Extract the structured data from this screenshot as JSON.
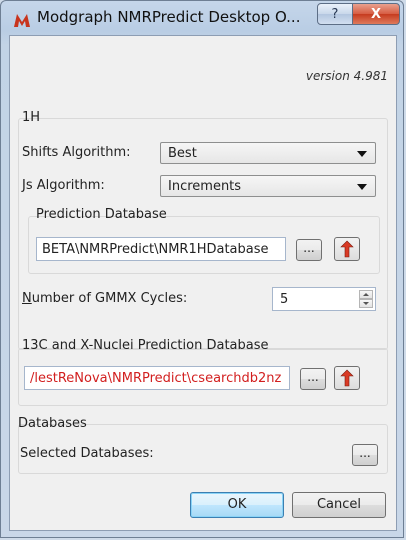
{
  "window": {
    "title": "Modgraph NMRPredict Desktop O...",
    "help_label": "?",
    "close_label": "X"
  },
  "version": "version 4.981",
  "h1_group": {
    "label": "1H",
    "shifts_label": "Shifts Algorithm:",
    "shifts_value": "Best",
    "js_label": "Js Algorithm:",
    "js_value": "Increments",
    "prediction_db": {
      "label": "Prediction Database",
      "path": "BETA\\NMRPredict\\NMR1HDatabase",
      "browse_label": "..."
    },
    "gmmx": {
      "label_prefix": "N",
      "label_rest": "umber of GMMX Cycles:",
      "value": "5"
    }
  },
  "c13_group": {
    "label": "13C and X-Nuclei Prediction Database",
    "path": "/lestReNova\\NMRPredict\\csearchdb2nz",
    "browse_label": "..."
  },
  "databases_group": {
    "label": "Databases",
    "selected_label": "Selected Databases:",
    "browse_label": "..."
  },
  "buttons": {
    "ok": "OK",
    "cancel": "Cancel"
  },
  "colors": {
    "path_text": "#d21f1f",
    "reset_arrow": "#d93a25",
    "close_button": "#c63b1f"
  },
  "icons": {
    "app": "modgraph-logo-icon",
    "reset": "reset-arrow-icon"
  }
}
